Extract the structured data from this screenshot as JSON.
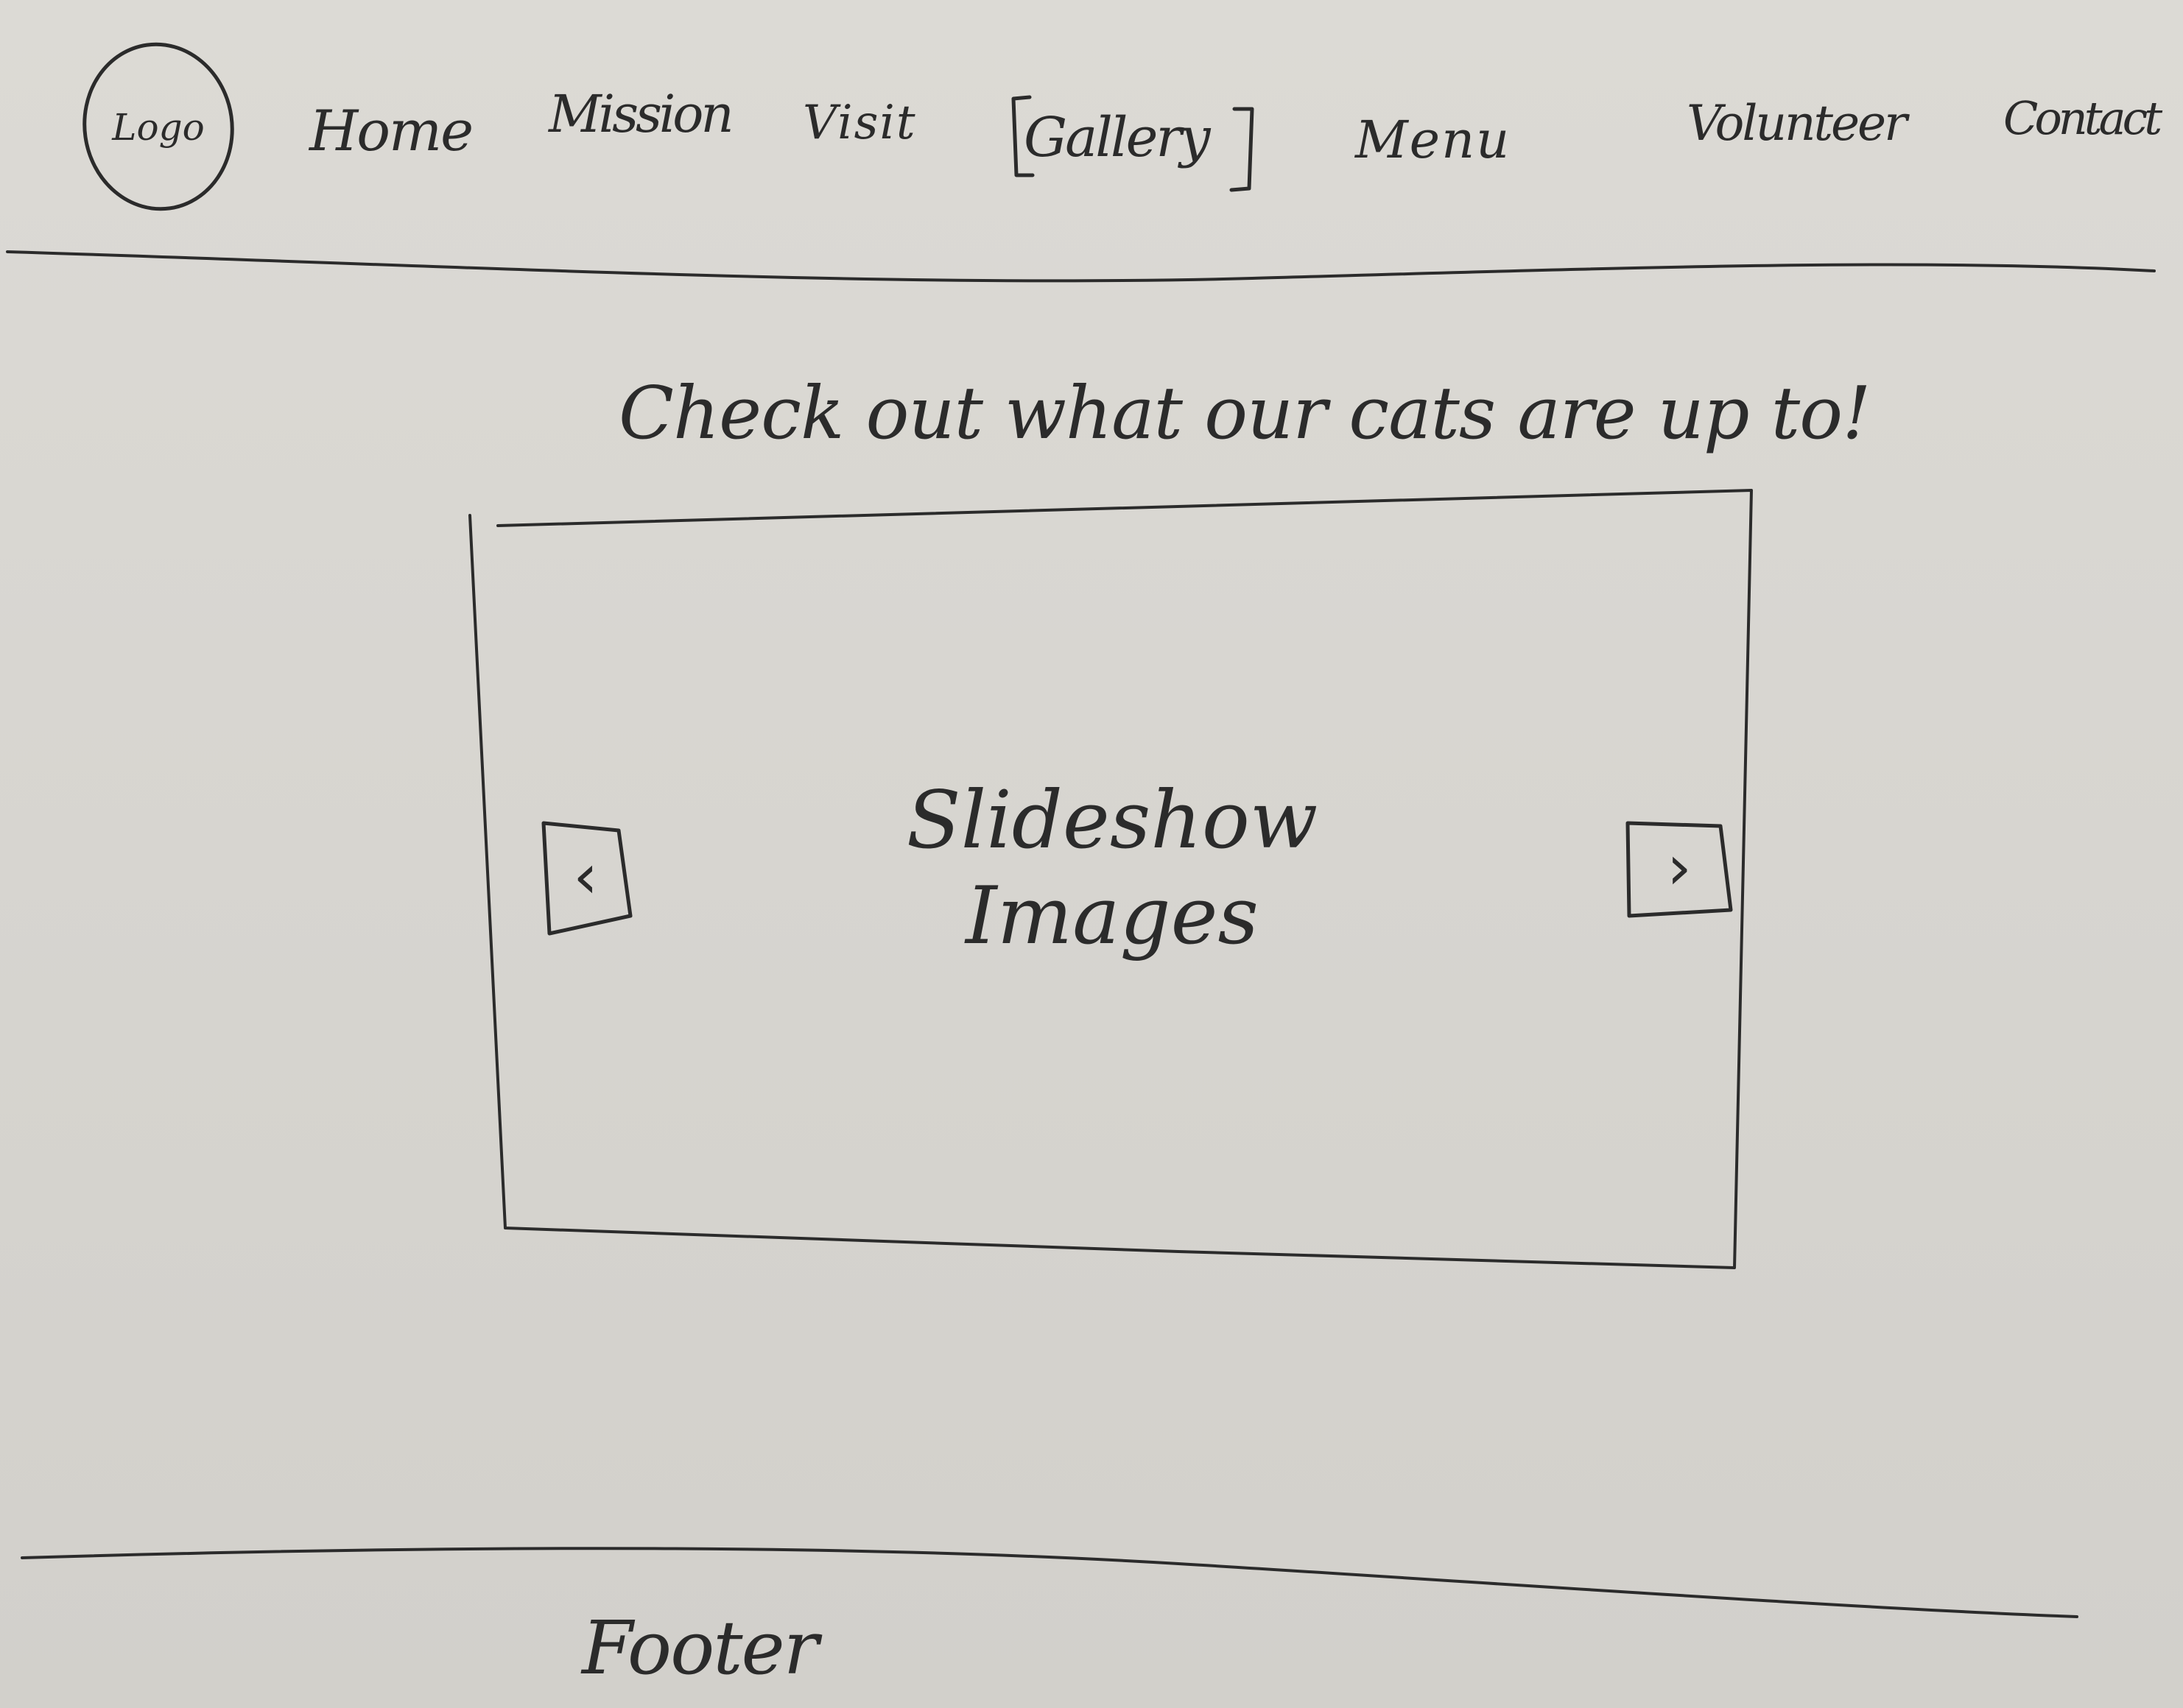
{
  "header": {
    "logo_label": "Logo",
    "nav": [
      {
        "label": "Home"
      },
      {
        "label": "Mission"
      },
      {
        "label": "Visit"
      },
      {
        "label": "Gallery",
        "selected": true
      },
      {
        "label": "Menu"
      },
      {
        "label": "Volunteer"
      },
      {
        "label": "Contact"
      }
    ]
  },
  "main": {
    "heading": "Check out what our cats are up to!",
    "slideshow": {
      "label_line1": "Slideshow",
      "label_line2": "Images",
      "prev_symbol": "‹",
      "next_symbol": "›",
      "prev_icon": "chevron-left-icon",
      "next_icon": "chevron-right-icon"
    }
  },
  "footer": {
    "label": "Footer"
  },
  "colors": {
    "paper": "#d8d6d1",
    "ink": "#2b2b2b"
  }
}
